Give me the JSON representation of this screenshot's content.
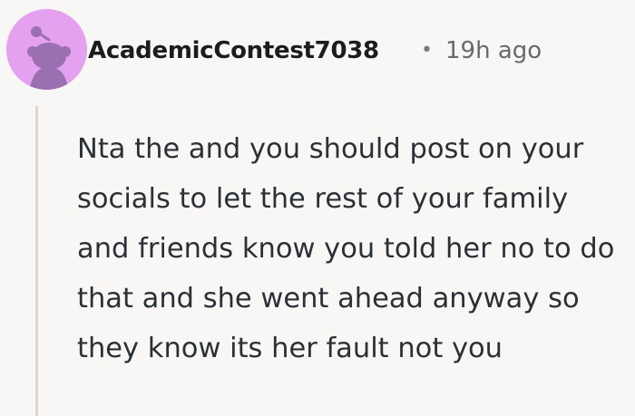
{
  "comment": {
    "author": "AcademicContest7038",
    "separator": "•",
    "time": "19h ago",
    "body": "Nta the and you should post on your socials to let the rest of your family and friends know you told her no to do that and she went ahead anyway so they know its her fault not you"
  },
  "avatar": {
    "icon": "snoo-avatar-icon",
    "background_color": "#e4a1f0",
    "figure_color": "#9a70b0"
  },
  "colors": {
    "background": "#f9f7f5",
    "author_text": "#1c1c1c",
    "meta_text": "#6a6a6a",
    "body_text": "#2a3136",
    "thread_line": "#dcd6d0"
  }
}
